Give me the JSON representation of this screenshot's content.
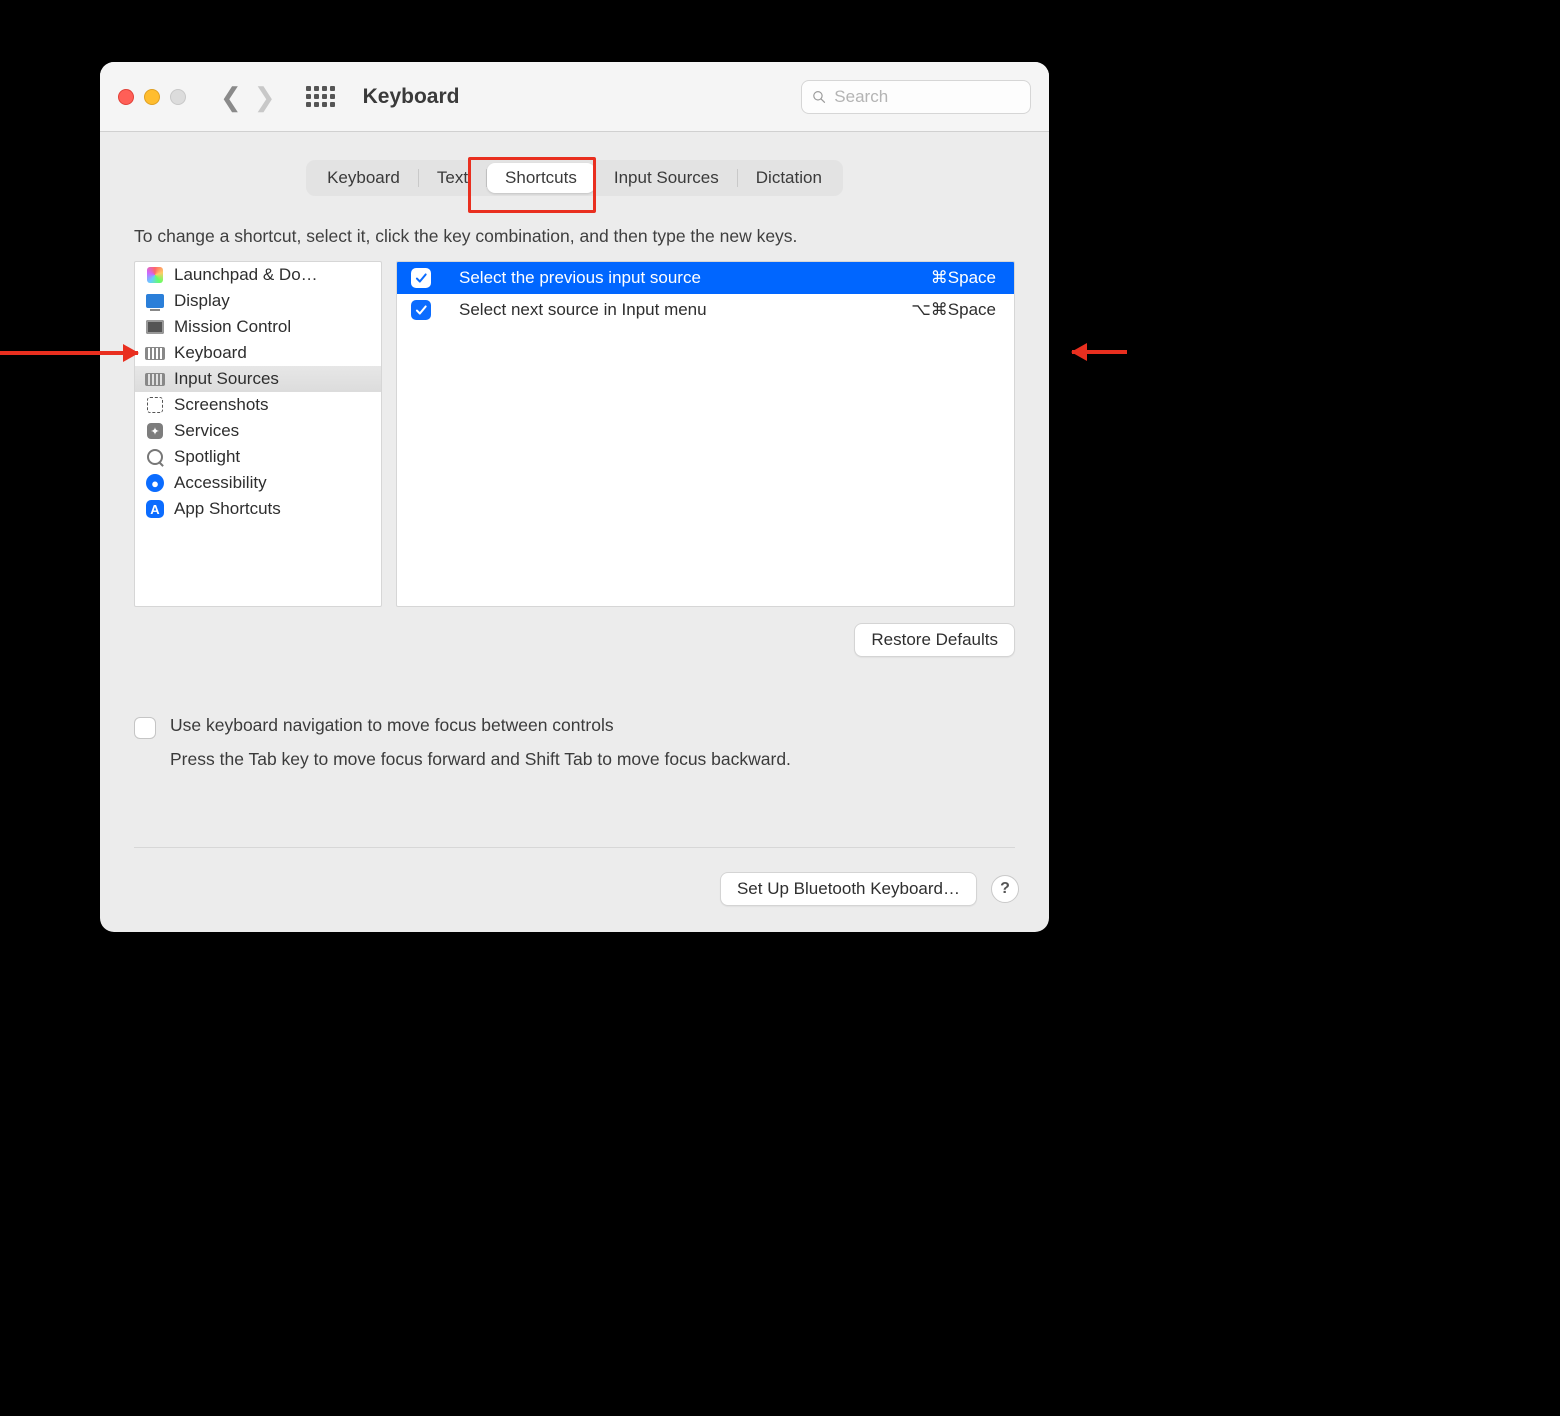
{
  "header": {
    "title": "Keyboard",
    "search_placeholder": "Search"
  },
  "tabs": [
    {
      "label": "Keyboard",
      "active": false
    },
    {
      "label": "Text",
      "active": false
    },
    {
      "label": "Shortcuts",
      "active": true
    },
    {
      "label": "Input Sources",
      "active": false
    },
    {
      "label": "Dictation",
      "active": false
    }
  ],
  "instruction": "To change a shortcut, select it, click the key combination, and then type the new keys.",
  "sidebar": {
    "items": [
      {
        "label": "Launchpad & Do…",
        "icon": "launchpad-icon",
        "selected": false
      },
      {
        "label": "Display",
        "icon": "display-icon",
        "selected": false
      },
      {
        "label": "Mission Control",
        "icon": "mission-control-icon",
        "selected": false
      },
      {
        "label": "Keyboard",
        "icon": "keyboard-icon",
        "selected": false
      },
      {
        "label": "Input Sources",
        "icon": "keyboard-icon",
        "selected": true
      },
      {
        "label": "Screenshots",
        "icon": "screenshots-icon",
        "selected": false
      },
      {
        "label": "Services",
        "icon": "services-icon",
        "selected": false
      },
      {
        "label": "Spotlight",
        "icon": "spotlight-icon",
        "selected": false
      },
      {
        "label": "Accessibility",
        "icon": "accessibility-icon",
        "selected": false
      },
      {
        "label": "App Shortcuts",
        "icon": "app-shortcuts-icon",
        "selected": false
      }
    ]
  },
  "shortcuts": [
    {
      "checked": true,
      "label": "Select the previous input source",
      "keys": "⌘Space",
      "selected": true
    },
    {
      "checked": true,
      "label": "Select next source in Input menu",
      "keys": "⌥⌘Space",
      "selected": false
    }
  ],
  "buttons": {
    "restore_defaults": "Restore Defaults",
    "setup_bluetooth": "Set Up Bluetooth Keyboard…",
    "help": "?"
  },
  "nav_focus": {
    "checked": false,
    "label": "Use keyboard navigation to move focus between controls",
    "sub": "Press the Tab key to move focus forward and Shift Tab to move focus backward."
  }
}
